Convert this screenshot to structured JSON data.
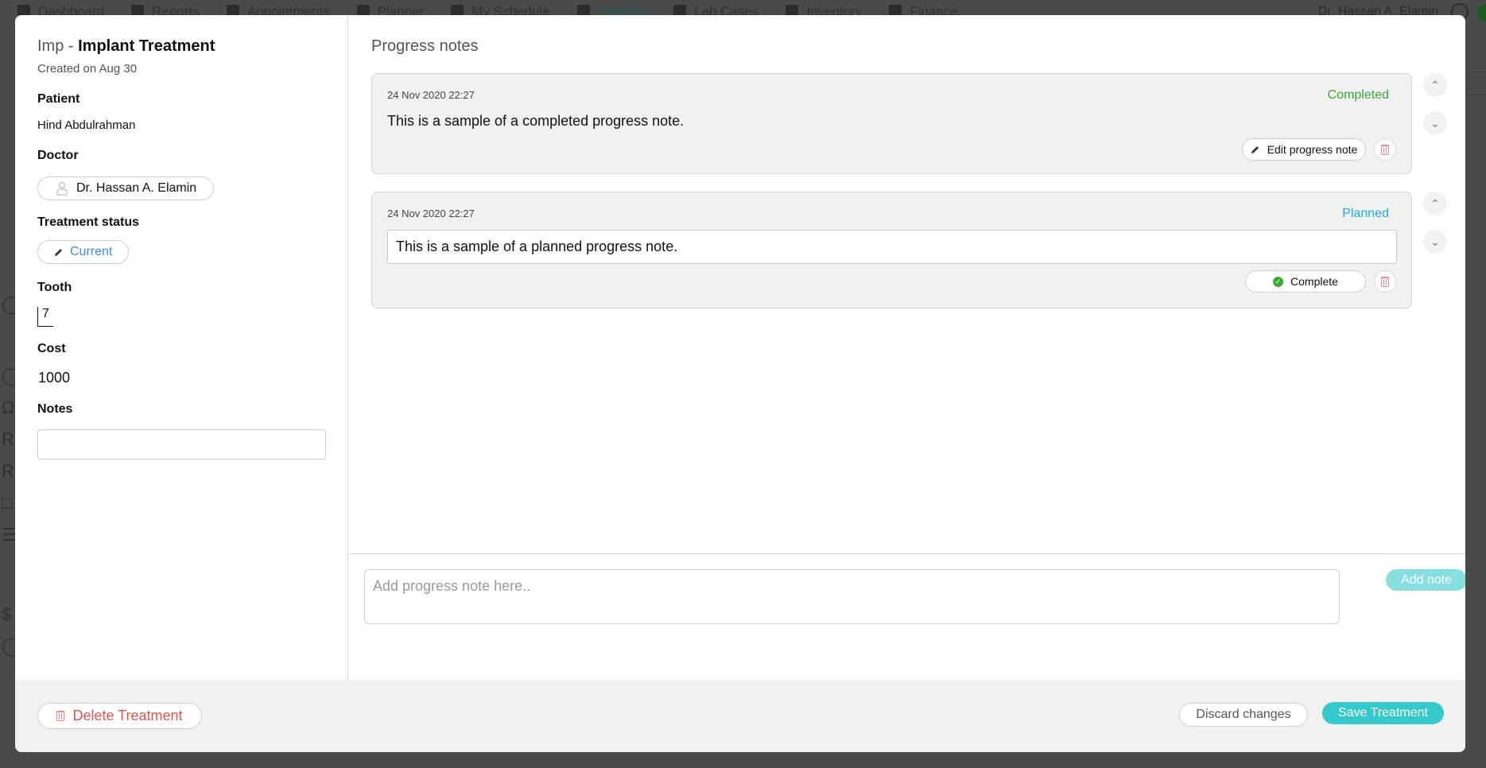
{
  "background": {
    "nav_items": [
      {
        "label": "Dashboard",
        "icon": "dashboard-icon"
      },
      {
        "label": "Reports",
        "icon": "reports-icon"
      },
      {
        "label": "Appointments",
        "icon": "calendar-icon"
      },
      {
        "label": "Planner",
        "icon": "planner-icon"
      },
      {
        "label": "My Schedule",
        "icon": "calendar-icon"
      },
      {
        "label": "Patients",
        "icon": "patients-icon",
        "active": true
      },
      {
        "label": "Lab Cases",
        "icon": "lab-icon"
      },
      {
        "label": "Inventory",
        "icon": "inventory-icon"
      },
      {
        "label": "Finance",
        "icon": "finance-icon"
      }
    ],
    "user_name": "Dr. Hassan A. Elamin"
  },
  "treatment": {
    "code": "Imp",
    "separator": " - ",
    "name": "Implant Treatment",
    "created": "Created on Aug 30",
    "patient_label": "Patient",
    "patient": "Hind Abdulrahman",
    "doctor_label": "Doctor",
    "doctor": "Dr. Hassan A. Elamin",
    "status_label": "Treatment status",
    "status": "Current",
    "tooth_label": "Tooth",
    "tooth": "7",
    "cost_label": "Cost",
    "cost": "1000",
    "notes_label": "Notes",
    "notes_value": ""
  },
  "progress_notes": {
    "title": "Progress notes",
    "items": [
      {
        "timestamp": "24 Nov 2020 22:27",
        "status": "Completed",
        "text": "This is a sample of a completed progress note.",
        "action_label": "Edit progress note"
      },
      {
        "timestamp": "24 Nov 2020 22:27",
        "status": "Planned",
        "text": "This is a sample of a planned progress note.",
        "action_label": "Complete"
      }
    ],
    "add_placeholder": "Add progress note here..",
    "add_button": "Add note"
  },
  "footer": {
    "delete_label": "Delete Treatment",
    "discard_label": "Discard changes",
    "save_label": "Save Treatment"
  },
  "colors": {
    "accent": "#36c9cb",
    "completed": "#3aaa35",
    "planned": "#22a9d6",
    "danger": "#e55050",
    "status_current": "#3b8de0"
  }
}
